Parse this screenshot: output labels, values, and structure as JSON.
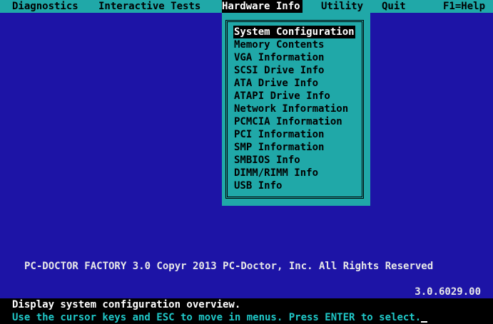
{
  "menubar": {
    "items": [
      {
        "label": "Diagnostics"
      },
      {
        "label": "Interactive Tests"
      },
      {
        "label": "Hardware Info",
        "active": true
      },
      {
        "label": "Utility"
      },
      {
        "label": "Quit"
      },
      {
        "label": "F1=Help"
      }
    ]
  },
  "dropdown": {
    "items": [
      {
        "label": "System Configuration",
        "selected": true
      },
      {
        "label": "Memory Contents"
      },
      {
        "label": "VGA Information"
      },
      {
        "label": "SCSI Drive Info"
      },
      {
        "label": "ATA Drive Info"
      },
      {
        "label": "ATAPI Drive Info"
      },
      {
        "label": "Network Information"
      },
      {
        "label": "PCMCIA Information"
      },
      {
        "label": "PCI Information"
      },
      {
        "label": "SMP Information"
      },
      {
        "label": "SMBIOS Info"
      },
      {
        "label": "DIMM/RIMM Info"
      },
      {
        "label": "USB Info"
      }
    ]
  },
  "copyright": "PC-DOCTOR FACTORY 3.0 Copyr 2013 PC-Doctor, Inc. All Rights Reserved",
  "version": "3.0.6029.00",
  "status": {
    "description": "Display system configuration overview.",
    "help": "Use the cursor keys and ESC to move in menus. Press ENTER to select."
  },
  "colors": {
    "background": "#1d14a6",
    "menubar": "#20a8a8",
    "highlight": "#000000",
    "help_text": "#20c8c8"
  }
}
